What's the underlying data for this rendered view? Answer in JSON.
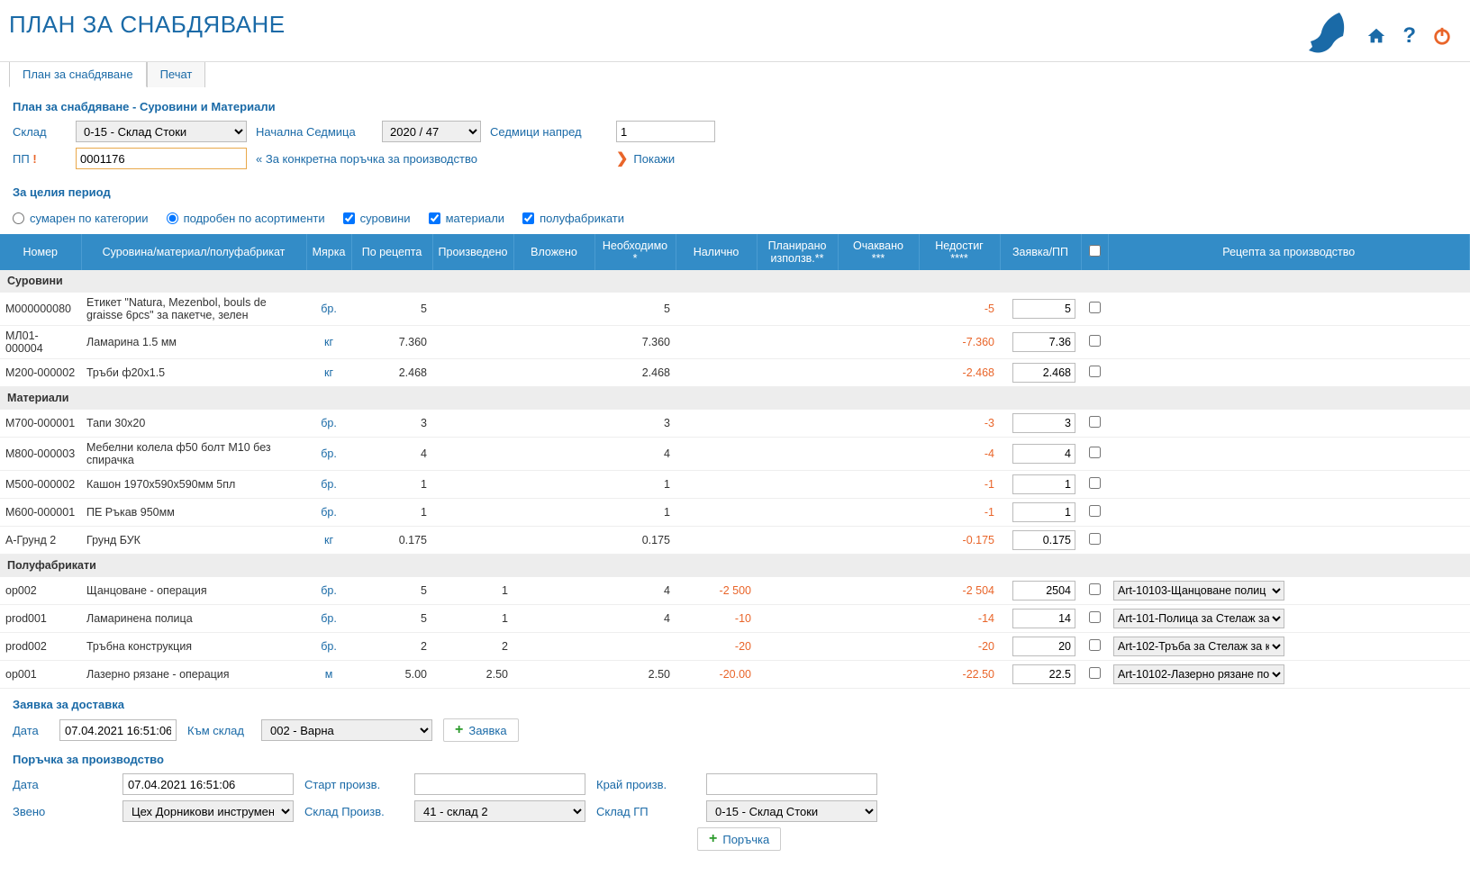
{
  "header": {
    "title": "ПЛАН ЗА СНАБДЯВАНЕ"
  },
  "tabs": [
    {
      "label": "План за снабдяване",
      "active": true
    },
    {
      "label": "Печат",
      "active": false
    }
  ],
  "section": "План за снабдяване - Суровини и Материали",
  "filters": {
    "warehouse_label": "Склад",
    "warehouse_value": "0-15 - Склад Стоки",
    "startweek_label": "Начална Седмица",
    "startweek_value": "2020 / 47",
    "weeks_ahead_label": "Седмици напред",
    "weeks_ahead_value": "1",
    "pp_label": "ПП",
    "pp_value": "0001176",
    "pp_note": "« За конкретна поръчка за производство",
    "show_label": "Покажи"
  },
  "period_section": "За целия период",
  "period_options": {
    "summary": "сумарен по категории",
    "detailed": "подробен по асортименти",
    "raw": "суровини",
    "materials": "материали",
    "semi": "полуфабрикати"
  },
  "columns": [
    "Номер",
    "Суровина/материал/полуфабрикат",
    "Мярка",
    "По рецепта",
    "Произведено",
    "Вложено",
    "Необходимо *",
    "Налично",
    "Планирано използв.**",
    "Очаквано ***",
    "Недостиг ****",
    "Заявка/ПП",
    "",
    "Рецепта за производство"
  ],
  "groups": [
    {
      "title": "Суровини",
      "rows": [
        {
          "code": "М000000080",
          "name": "Етикет \"Natura, Mezenbol, bouls de graisse 6pcs\" за пакетче, зелен",
          "uom": "бр.",
          "recipe": "5",
          "produced": "",
          "used": "",
          "needed": "5",
          "stock": "",
          "planned": "",
          "expected": "",
          "shortage": "-5",
          "order": "5",
          "recipe_sel": ""
        },
        {
          "code": "МЛ01-000004",
          "name": "Ламарина 1.5 мм",
          "uom": "кг",
          "recipe": "7.360",
          "produced": "",
          "used": "",
          "needed": "7.360",
          "stock": "",
          "planned": "",
          "expected": "",
          "shortage": "-7.360",
          "order": "7.36",
          "recipe_sel": ""
        },
        {
          "code": "М200-000002",
          "name": "Тръби ф20х1.5",
          "uom": "кг",
          "recipe": "2.468",
          "produced": "",
          "used": "",
          "needed": "2.468",
          "stock": "",
          "planned": "",
          "expected": "",
          "shortage": "-2.468",
          "order": "2.468",
          "recipe_sel": ""
        }
      ]
    },
    {
      "title": "Материали",
      "rows": [
        {
          "code": "М700-000001",
          "name": "Тапи 30х20",
          "uom": "бр.",
          "recipe": "3",
          "produced": "",
          "used": "",
          "needed": "3",
          "stock": "",
          "planned": "",
          "expected": "",
          "shortage": "-3",
          "order": "3",
          "recipe_sel": ""
        },
        {
          "code": "М800-000003",
          "name": "Мебелни колела ф50 болт М10 без спирачка",
          "uom": "бр.",
          "recipe": "4",
          "produced": "",
          "used": "",
          "needed": "4",
          "stock": "",
          "planned": "",
          "expected": "",
          "shortage": "-4",
          "order": "4",
          "recipe_sel": ""
        },
        {
          "code": "М500-000002",
          "name": "Кашон 1970х590х590мм 5пл",
          "uom": "бр.",
          "recipe": "1",
          "produced": "",
          "used": "",
          "needed": "1",
          "stock": "",
          "planned": "",
          "expected": "",
          "shortage": "-1",
          "order": "1",
          "recipe_sel": ""
        },
        {
          "code": "М600-000001",
          "name": "ПЕ Ръкав 950мм",
          "uom": "бр.",
          "recipe": "1",
          "produced": "",
          "used": "",
          "needed": "1",
          "stock": "",
          "planned": "",
          "expected": "",
          "shortage": "-1",
          "order": "1",
          "recipe_sel": ""
        },
        {
          "code": "А-Грунд 2",
          "name": "Грунд БУК",
          "uom": "кг",
          "recipe": "0.175",
          "produced": "",
          "used": "",
          "needed": "0.175",
          "stock": "",
          "planned": "",
          "expected": "",
          "shortage": "-0.175",
          "order": "0.175",
          "recipe_sel": ""
        }
      ]
    },
    {
      "title": "Полуфабрикати",
      "rows": [
        {
          "code": "op002",
          "name": "Щанцоване - операция",
          "uom": "бр.",
          "recipe": "5",
          "produced": "1",
          "used": "",
          "needed": "4",
          "stock": "-2 500",
          "planned": "",
          "expected": "",
          "shortage": "-2 504",
          "order": "2504",
          "recipe_sel": "Art-10103-Щанцоване полиц"
        },
        {
          "code": "prod001",
          "name": "Ламаринена полица",
          "uom": "бр.",
          "recipe": "5",
          "produced": "1",
          "used": "",
          "needed": "4",
          "stock": "-10",
          "planned": "",
          "expected": "",
          "shortage": "-14",
          "order": "14",
          "recipe_sel": "Art-101-Полица за Стелаж за"
        },
        {
          "code": "prod002",
          "name": "Тръбна конструкция",
          "uom": "бр.",
          "recipe": "2",
          "produced": "2",
          "used": "",
          "needed": "",
          "stock": "-20",
          "planned": "",
          "expected": "",
          "shortage": "-20",
          "order": "20",
          "recipe_sel": "Art-102-Тръба за Стелаж за к"
        },
        {
          "code": "op001",
          "name": "Лазерно рязане - операция",
          "uom": "м",
          "recipe": "5.00",
          "produced": "2.50",
          "used": "",
          "needed": "2.50",
          "stock": "-20.00",
          "planned": "",
          "expected": "",
          "shortage": "-22.50",
          "order": "22.5",
          "recipe_sel": "Art-10102-Лазерно рязане по"
        }
      ]
    }
  ],
  "delivery": {
    "title": "Заявка за доставка",
    "date_label": "Дата",
    "date_value": "07.04.2021 16:51:06",
    "to_wh_label": "Към склад",
    "to_wh_value": "002 - Варна",
    "btn": "Заявка"
  },
  "production": {
    "title": "Поръчка за производство",
    "date_label": "Дата",
    "date_value": "07.04.2021 16:51:06",
    "start_label": "Старт произв.",
    "start_value": "",
    "end_label": "Край произв.",
    "end_value": "",
    "unit_label": "Звено",
    "unit_value": "Цех Дорникови инструменти",
    "pwh_label": "Склад Произв.",
    "pwh_value": "41 - склад 2",
    "gpwh_label": "Склад ГП",
    "gpwh_value": "0-15 - Склад Стоки",
    "btn": "Поръчка"
  }
}
